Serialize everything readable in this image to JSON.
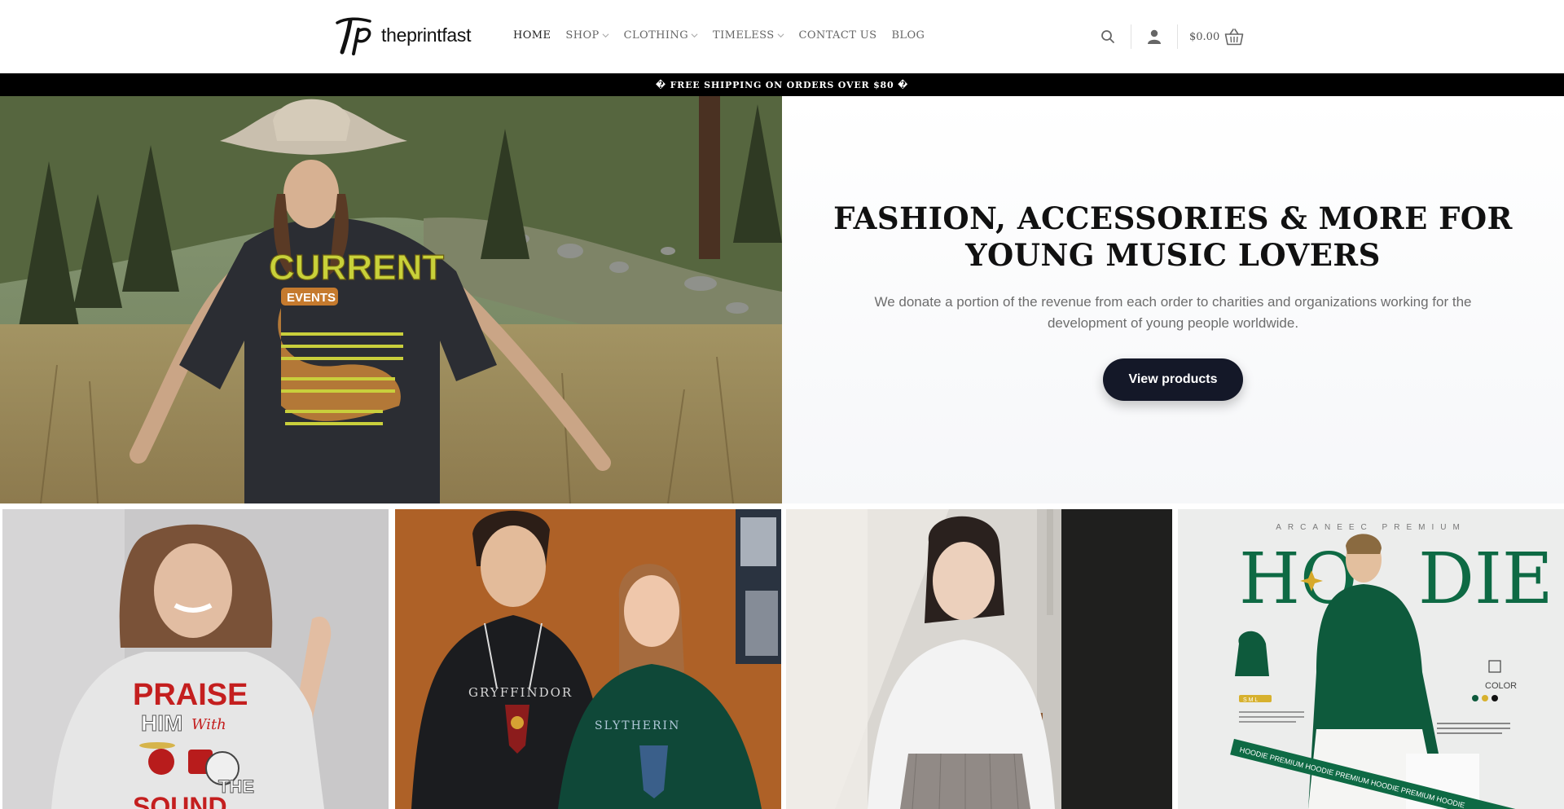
{
  "header": {
    "logo_text": "theprintfast",
    "nav": [
      {
        "label": "HOME",
        "dropdown": false,
        "active": true
      },
      {
        "label": "SHOP",
        "dropdown": true,
        "active": false
      },
      {
        "label": "CLOTHING",
        "dropdown": true,
        "active": false
      },
      {
        "label": "TIMELESS",
        "dropdown": true,
        "active": false
      },
      {
        "label": "CONTACT US",
        "dropdown": false,
        "active": false
      },
      {
        "label": "BLOG",
        "dropdown": false,
        "active": false
      }
    ],
    "cart_total": "$0.00",
    "icons": [
      "search-icon",
      "account-icon",
      "cart-basket-icon"
    ]
  },
  "announcement": {
    "text": "� FREE SHIPPING ON ORDERS OVER $80 �"
  },
  "hero": {
    "title_line1": "FASHION, ACCESSORIES & MORE FOR",
    "title_line2": "YOUNG MUSIC LOVERS",
    "text": "We donate a portion of the revenue from each order to charities and organizations working for the development of young people worldwide.",
    "button_label": "View products",
    "shirt_print": {
      "line1": "CURRENT",
      "line2": "EVENTS"
    }
  },
  "tiles": [
    {
      "print_line1": "PRAISE",
      "print_line2": "HIM",
      "print_line3": "With",
      "print_line4": "THE",
      "print_line5": "SOUND"
    },
    {
      "hoodie_left": "GRYFFINDOR",
      "hoodie_right": "SLYTHERIN"
    },
    {},
    {
      "brand": "ARCANEEC  PREMIUM",
      "headline_a": "HO",
      "headline_b": "DIE",
      "color_label": "COLOR",
      "tag": "S M L",
      "banner": "HOODIE   PREMIUM HOODIE   PREMIUM HOODIE   PREMIUM HOODIE"
    }
  ],
  "colors": {
    "accent_button": "#141828",
    "announce_bg": "#000000",
    "hoodie_green": "#0e5a3c"
  }
}
